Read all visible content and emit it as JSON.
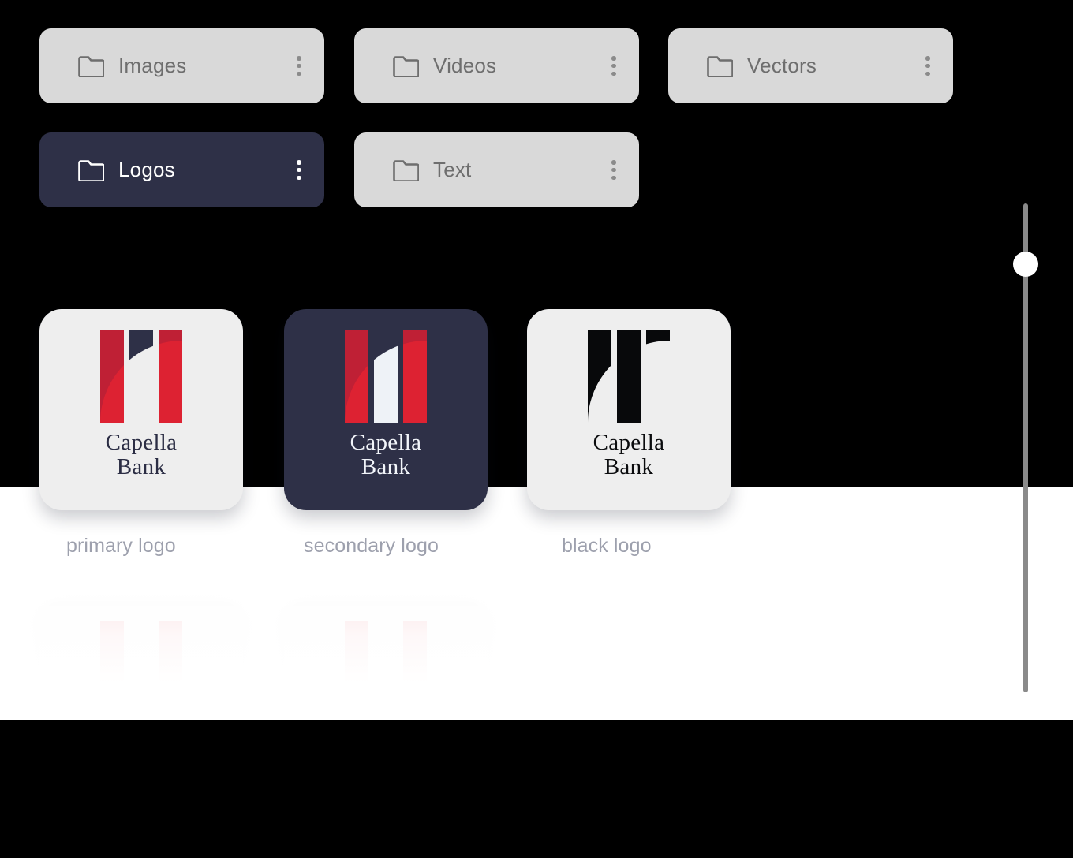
{
  "folders": {
    "items": [
      {
        "label": "Images",
        "icon": "folder-icon",
        "menu_icon": "kebab-menu-icon",
        "active": false
      },
      {
        "label": "Videos",
        "icon": "folder-icon",
        "menu_icon": "kebab-menu-icon",
        "active": false
      },
      {
        "label": "Vectors",
        "icon": "folder-icon",
        "menu_icon": "kebab-menu-icon",
        "active": false
      },
      {
        "label": "Logos",
        "icon": "folder-icon",
        "menu_icon": "kebab-menu-icon",
        "active": true
      },
      {
        "label": "Text",
        "icon": "folder-icon",
        "menu_icon": "kebab-menu-icon",
        "active": false
      }
    ]
  },
  "assets": {
    "brand_name_line1": "Capella",
    "brand_name_line2": "Bank",
    "cards": [
      {
        "caption": "primary logo",
        "variant": "light",
        "mark": "capella-bank-logo-mark"
      },
      {
        "caption": "secondary logo",
        "variant": "dark",
        "mark": "capella-bank-logo-mark"
      },
      {
        "caption": "black logo",
        "variant": "black",
        "mark": "capella-bank-logo-mark"
      }
    ]
  },
  "scrollbar": {
    "thumb_icon": "slider-thumb-handle"
  },
  "colors": {
    "navy": "#2e3047",
    "red_light": "#dd2232",
    "red_dark": "#bf2035",
    "black": "#08090b",
    "chip_idle_bg": "#d9d9d9",
    "chip_text": "#6e6e6e",
    "caption_text": "#9da0ad",
    "card_bg": "#eeeeee",
    "offwhite": "#eef2f7"
  }
}
